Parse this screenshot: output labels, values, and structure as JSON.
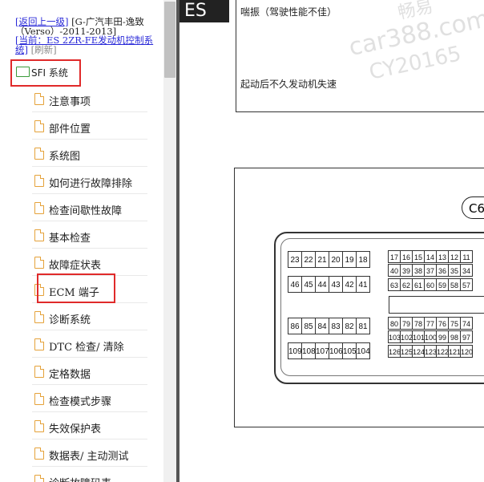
{
  "breadcrumb": {
    "back": "[返回上一级]",
    "parent": "[G-广汽丰田-逸致（Verso）-2011-2013]",
    "current_prefix": "[当前：",
    "current_name": "ES 2ZR-FE发动机控制系统]",
    "refresh": "[刷新]"
  },
  "tree": {
    "root": "SFI 系统",
    "items": [
      "注意事项",
      "部件位置",
      "系统图",
      "如何进行故障排除",
      "检查间歇性故障",
      "基本检查",
      "故障症状表",
      "ECM 端子",
      "诊断系统",
      "DTC 检查/ 清除",
      "定格数据",
      "检查模式步骤",
      "失效保护表",
      "数据表/ 主动测试",
      "诊断故障码表"
    ]
  },
  "doc": {
    "section": "ES",
    "row1": "喘振（驾驶性能不佳）",
    "row2": "起动后不久发动机失速",
    "connector_label": "C6",
    "watermark": [
      "car388.com",
      "CY20165",
      "畅易"
    ],
    "pins_top_left_row1": [
      "23",
      "22",
      "21",
      "20",
      "19",
      "18"
    ],
    "pins_top_left_row2": [
      "46",
      "45",
      "44",
      "43",
      "42",
      "41"
    ],
    "pins_top_right_row1": [
      "17",
      "16",
      "15",
      "14",
      "13",
      "12",
      "11"
    ],
    "pins_top_right_row2": [
      "40",
      "39",
      "38",
      "37",
      "36",
      "35",
      "34"
    ],
    "pins_top_right_row3": [
      "63",
      "62",
      "61",
      "60",
      "59",
      "58",
      "57"
    ],
    "pins_bot_left_row1": [
      "86",
      "85",
      "84",
      "83",
      "82",
      "81"
    ],
    "pins_bot_left_row2": [
      "109",
      "108",
      "107",
      "106",
      "105",
      "104"
    ],
    "pins_bot_right_row1": [
      "80",
      "79",
      "78",
      "77",
      "76",
      "75",
      "74"
    ],
    "pins_bot_right_row2": [
      "103",
      "102",
      "101",
      "100",
      "99",
      "98",
      "97"
    ],
    "pins_bot_right_row3": [
      "126",
      "125",
      "124",
      "123",
      "122",
      "121",
      "120"
    ]
  }
}
